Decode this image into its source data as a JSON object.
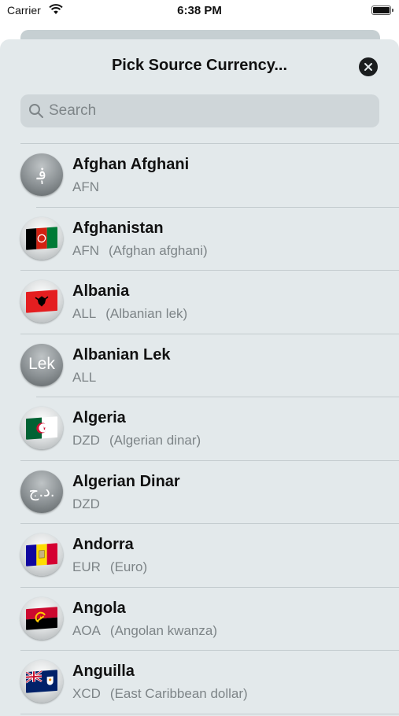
{
  "status_bar": {
    "carrier": "Carrier",
    "time": "6:38 PM"
  },
  "sheet": {
    "title": "Pick Source Currency...",
    "search": {
      "placeholder": "Search",
      "value": ""
    }
  },
  "items": [
    {
      "name": "Afghan Afghani",
      "code": "AFN",
      "full": "",
      "icon": "afghani-symbol-icon",
      "symbol": "؋"
    },
    {
      "name": "Afghanistan",
      "code": "AFN",
      "full": "(Afghan afghani)",
      "icon": "afghanistan-flag-icon"
    },
    {
      "name": "Albania",
      "code": "ALL",
      "full": "(Albanian lek)",
      "icon": "albania-flag-icon"
    },
    {
      "name": "Albanian Lek",
      "code": "ALL",
      "full": "",
      "icon": "lek-symbol-icon",
      "symbol": "Lek"
    },
    {
      "name": "Algeria",
      "code": "DZD",
      "full": "(Algerian dinar)",
      "icon": "algeria-flag-icon"
    },
    {
      "name": "Algerian Dinar",
      "code": "DZD",
      "full": "",
      "icon": "dinar-symbol-icon",
      "symbol": "د.ج."
    },
    {
      "name": "Andorra",
      "code": "EUR",
      "full": "(Euro)",
      "icon": "andorra-flag-icon"
    },
    {
      "name": "Angola",
      "code": "AOA",
      "full": "(Angolan kwanza)",
      "icon": "angola-flag-icon"
    },
    {
      "name": "Anguilla",
      "code": "XCD",
      "full": "(East Caribbean dollar)",
      "icon": "anguilla-flag-icon"
    }
  ]
}
